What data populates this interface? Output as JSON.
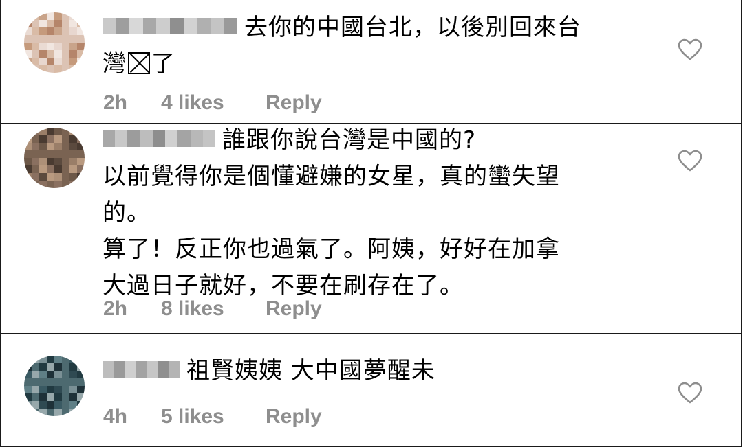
{
  "comments": [
    {
      "line1": "去你的中國台北，以後別回來台",
      "line2_before": "灣",
      "line2_after": "了",
      "time": "2h",
      "likes": "4 likes",
      "reply": "Reply",
      "avatar_colors": [
        "#e8d7cf",
        "#dcc3b4",
        "#c9a48a",
        "#b5856a",
        "#c59a7c",
        "#d9bba6",
        "#eadbd3",
        "#f1e6e0"
      ],
      "username_colors": [
        "#c9c9c9",
        "#9e9e9e",
        "#d8d8d8",
        "#a8a8a8",
        "#cdcdcd",
        "#8f8f8f",
        "#d2d2d2",
        "#b0b0b0",
        "#c4c4c4",
        "#9a9a9a"
      ]
    },
    {
      "lines": [
        "誰跟你說台灣是中國的?",
        "以前覺得你是個懂避嫌的女星，真的蠻失望",
        "的。",
        "算了！反正你也過氣了。阿姨，好好在加拿",
        "大過日子就好，不要在刷存在了。"
      ],
      "time": "2h",
      "likes": "8 likes",
      "reply": "Reply",
      "avatar_colors": [
        "#5b4a3e",
        "#7a6352",
        "#9a7e68",
        "#b99a80",
        "#6d5848",
        "#8a7060",
        "#ad9078",
        "#4a3b31"
      ],
      "username_colors": [
        "#a8a8a8",
        "#c8c8c8",
        "#9c9c9c",
        "#bdbdbd",
        "#8e8e8e",
        "#d0d0d0",
        "#a4a4a4",
        "#b8b8b8",
        "#c4c4c4"
      ]
    },
    {
      "lines": [
        "祖賢姨姨 大中國夢醒未"
      ],
      "time": "4h",
      "likes": "5 likes",
      "reply": "Reply",
      "avatar_colors": [
        "#2f4a52",
        "#4d6a70",
        "#7a9095",
        "#1e3138",
        "#5f7f86",
        "#97a8ab",
        "#3a5a63",
        "#213a41"
      ],
      "username_colors": [
        "#bdbdbd",
        "#9a9a9a",
        "#cfcfcf",
        "#a3a3a3",
        "#c6c6c6",
        "#8f8f8f",
        "#b4b4b4"
      ]
    }
  ],
  "icons": {
    "like": "heart-outline-icon"
  },
  "colors": {
    "meta": "#8e8e8e",
    "border": "#1a1a1a"
  }
}
